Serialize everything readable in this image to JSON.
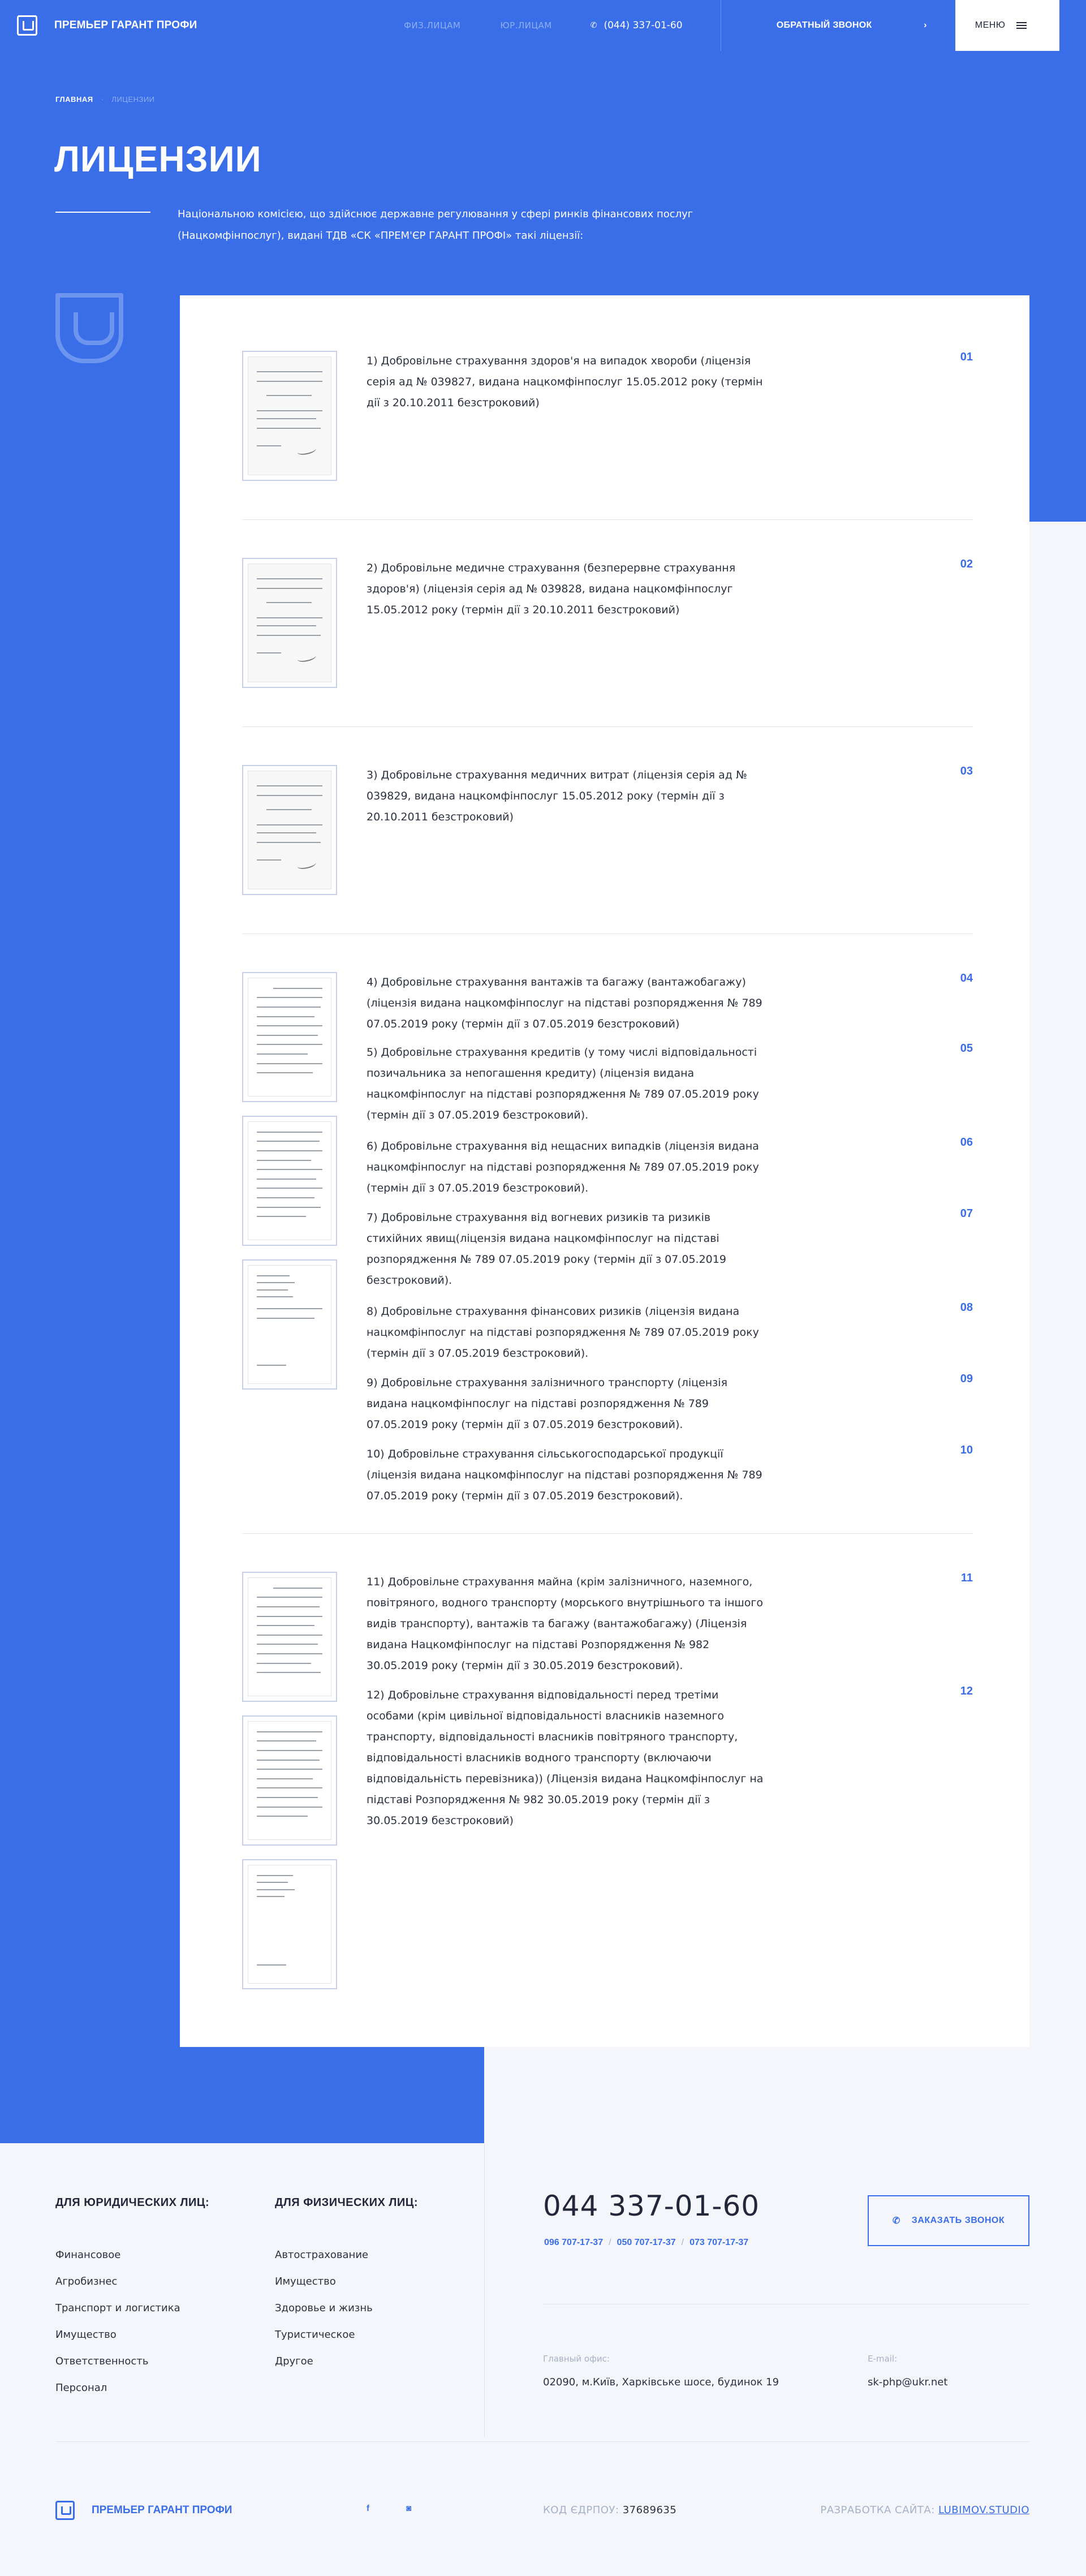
{
  "header": {
    "logo_text": "ПРЕМЬЕР ГАРАНТ ПРОФИ",
    "nav": [
      "ФИЗ.ЛИЦАМ",
      "ЮР.ЛИЦАМ"
    ],
    "phone": "(044) 337-01-60",
    "callback_label": "ОБРАТНЫЙ ЗВОНОК",
    "callback_arrow": "›",
    "menu_label": "МЕНЮ"
  },
  "breadcrumb": {
    "home": "ГЛАВНАЯ",
    "separator": "·",
    "current": "ЛИЦЕНЗИИ"
  },
  "page_title": "ЛИЦЕНЗИИ",
  "intro": "Національною комісією, що здійснює державне регулювання у сфері ринків фінансових послуг (Нацкомфінпослуг), видані ТДВ «СК «ПРЕМ'ЄР ГАРАНТ ПРОФІ» такі ліцензії:",
  "licenses": [
    {
      "num": "01",
      "text": "1) Добровільне страхування здоров'я на випадок хвороби (ліцензія серія ад № 039827, видана нацкомфінпослуг 15.05.2012 року (термін дії з 20.10.2011 безстроковий)"
    },
    {
      "num": "02",
      "text": "2) Добровільне медичне страхування (безперервне страхування здоров'я) (ліцензія серія ад № 039828, видана нацкомфінпослуг 15.05.2012 року (термін дії з 20.10.2011 безстроковий)"
    },
    {
      "num": "03",
      "text": "3) Добровільне страхування медичних витрат (ліцензія серія ад № 039829, видана нацкомфінпослуг 15.05.2012 року (термін дії з 20.10.2011 безстроковий)"
    },
    {
      "num": "04",
      "text": "4) Добровільне страхування вантажів та багажу (вантажобагажу) (ліцензія видана нацкомфінпослуг на підставі розпорядження № 789 07.05.2019 року (термін дії з 07.05.2019 безстроковий)"
    },
    {
      "num": "05",
      "text": "5) Добровільне страхування кредитів (у тому числі відповідальності позичальника за непогашення кредиту) (ліцензія видана нацкомфінпослуг на підставі розпорядження № 789 07.05.2019 року (термін дії з 07.05.2019 безстроковий)."
    },
    {
      "num": "06",
      "text": "6) Добровільне страхування від нещасних випадків (ліцензія видана нацкомфінпослуг на підставі розпорядження № 789 07.05.2019 року (термін дії з 07.05.2019 безстроковий)."
    },
    {
      "num": "07",
      "text": "7) Добровільне страхування від вогневих ризиків та ризиків стихійних явищ(ліцензія видана нацкомфінпослуг на підставі розпорядження № 789 07.05.2019 року (термін дії з 07.05.2019 безстроковий)."
    },
    {
      "num": "08",
      "text": "8) Добровільне страхування фінансових ризиків (ліцензія видана нацкомфінпослуг на підставі розпорядження № 789 07.05.2019 року (термін дії з 07.05.2019 безстроковий)."
    },
    {
      "num": "09",
      "text": "9) Добровільне страхування залізничного транспорту (ліцензія видана нацкомфінпослуг на підставі розпорядження № 789 07.05.2019 року (термін дії з 07.05.2019 безстроковий)."
    },
    {
      "num": "10",
      "text": "10) Добровільне страхування сільськогосподарської продукції (ліцензія видана нацкомфінпослуг на підставі розпорядження № 789 07.05.2019 року (термін дії з 07.05.2019 безстроковий)."
    },
    {
      "num": "11",
      "text": "11) Добровільне страхування майна (крім залізничного, наземного, повітряного, водного транспорту (морського внутрішнього та іншого видів транспорту), вантажів та багажу (вантажобагажу) (Ліцензія видана Нацкомфінпослуг на підставі Розпорядження № 982 30.05.2019 року (термін дії з 30.05.2019 безстроковий)."
    },
    {
      "num": "12",
      "text": "12) Добровільне страхування відповідальності перед третіми особами (крім цивільної відповідальності власників наземного транспорту, відповідальності власників повітряного транспорту, відповідальності власників водного транспорту (включаючи відповідальність перевізника)) (Ліцензія видана Нацкомфінпослуг на підставі Розпорядження № 982 30.05.2019 року (термін дії з 30.05.2019 безстроковий)"
    }
  ],
  "footer": {
    "legal_title": "ДЛЯ ЮРИДИЧЕСКИХ ЛИЦ:",
    "legal_items": [
      "Финансовое",
      "Агробизнес",
      "Транспорт и логистика",
      "Имущество",
      "Ответственность",
      "Персонал"
    ],
    "private_title": "ДЛЯ ФИЗИЧЕСКИХ ЛИЦ:",
    "private_items": [
      "Автострахование",
      "Имущество",
      "Здоровье и жизнь",
      "Туристическое",
      "Другое"
    ],
    "main_phone": "044 337-01-60",
    "phones": [
      "096 707-17-37",
      "050 707-17-37",
      "073 707-17-37"
    ],
    "phones_sep": "/",
    "order_call": "ЗАКАЗАТЬ ЗВОНОК",
    "office_label": "Главный офис:",
    "office_value": "02090, м.Київ, Харківське шосе, будинок 19",
    "email_label": "E-mail:",
    "email_value": "sk-php@ukr.net",
    "logo_text": "ПРЕМЬЕР ГАРАНТ ПРОФИ",
    "social_fb": "f",
    "social_ig": "◙",
    "edrpou_label": "КОД ЄДРПОУ:",
    "edrpou_value": "37689635",
    "dev_label": "РАЗРАБОТКА САЙТА:",
    "dev_value": "LUBIMOV.STUDIO"
  },
  "colors": {
    "accent": "#3a6ee8",
    "background": "#f4f6fb"
  }
}
